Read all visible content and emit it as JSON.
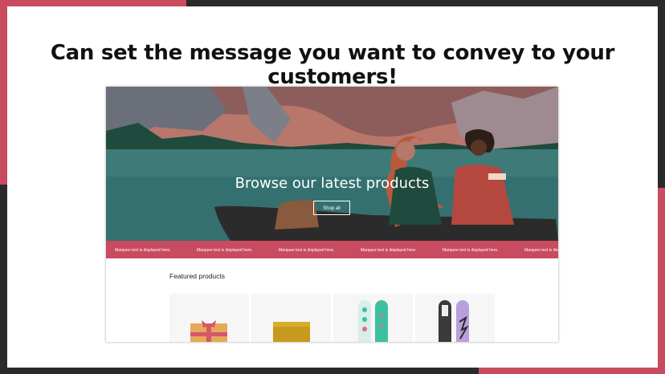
{
  "headline": "Can set the message you want to convey to your customers!",
  "colors": {
    "accent": "#c94b5f",
    "dark": "#2a2a2a",
    "lake": "#3d7a78",
    "marquee_bg": "#c94b5f"
  },
  "hero": {
    "title": "Browse our latest products",
    "button_label": "Shop all"
  },
  "marquee": {
    "items": [
      "Marquee text is displayed here.",
      "Marquee text is displayed here.",
      "Marquee text is displayed here.",
      "Marquee text is displayed here.",
      "Marquee text is displayed here.",
      "Marquee text is displayed here."
    ]
  },
  "featured": {
    "heading": "Featured products",
    "products": [
      {
        "icon": "gift-card-icon"
      },
      {
        "icon": "wax-bar-icon"
      },
      {
        "icon": "snowboard-teal-icon"
      },
      {
        "icon": "snowboard-purple-icon"
      }
    ]
  }
}
